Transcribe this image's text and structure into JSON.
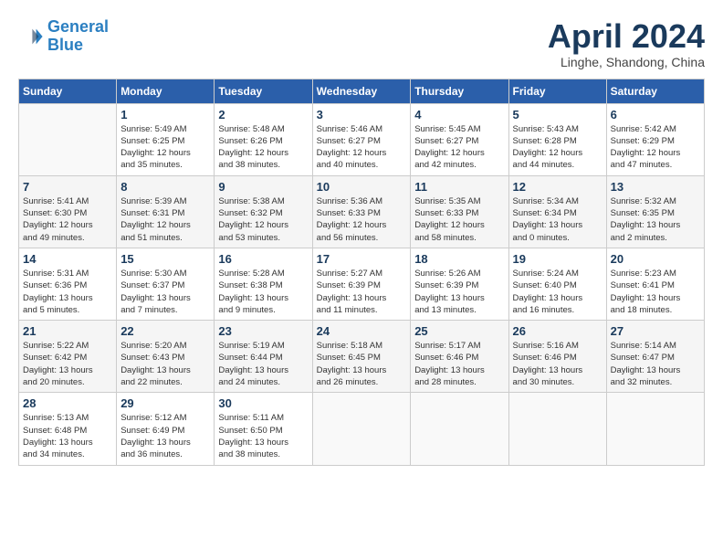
{
  "header": {
    "logo_line1": "General",
    "logo_line2": "Blue",
    "month": "April 2024",
    "location": "Linghe, Shandong, China"
  },
  "days_of_week": [
    "Sunday",
    "Monday",
    "Tuesday",
    "Wednesday",
    "Thursday",
    "Friday",
    "Saturday"
  ],
  "weeks": [
    [
      {
        "num": "",
        "info": ""
      },
      {
        "num": "1",
        "info": "Sunrise: 5:49 AM\nSunset: 6:25 PM\nDaylight: 12 hours\nand 35 minutes."
      },
      {
        "num": "2",
        "info": "Sunrise: 5:48 AM\nSunset: 6:26 PM\nDaylight: 12 hours\nand 38 minutes."
      },
      {
        "num": "3",
        "info": "Sunrise: 5:46 AM\nSunset: 6:27 PM\nDaylight: 12 hours\nand 40 minutes."
      },
      {
        "num": "4",
        "info": "Sunrise: 5:45 AM\nSunset: 6:27 PM\nDaylight: 12 hours\nand 42 minutes."
      },
      {
        "num": "5",
        "info": "Sunrise: 5:43 AM\nSunset: 6:28 PM\nDaylight: 12 hours\nand 44 minutes."
      },
      {
        "num": "6",
        "info": "Sunrise: 5:42 AM\nSunset: 6:29 PM\nDaylight: 12 hours\nand 47 minutes."
      }
    ],
    [
      {
        "num": "7",
        "info": "Sunrise: 5:41 AM\nSunset: 6:30 PM\nDaylight: 12 hours\nand 49 minutes."
      },
      {
        "num": "8",
        "info": "Sunrise: 5:39 AM\nSunset: 6:31 PM\nDaylight: 12 hours\nand 51 minutes."
      },
      {
        "num": "9",
        "info": "Sunrise: 5:38 AM\nSunset: 6:32 PM\nDaylight: 12 hours\nand 53 minutes."
      },
      {
        "num": "10",
        "info": "Sunrise: 5:36 AM\nSunset: 6:33 PM\nDaylight: 12 hours\nand 56 minutes."
      },
      {
        "num": "11",
        "info": "Sunrise: 5:35 AM\nSunset: 6:33 PM\nDaylight: 12 hours\nand 58 minutes."
      },
      {
        "num": "12",
        "info": "Sunrise: 5:34 AM\nSunset: 6:34 PM\nDaylight: 13 hours\nand 0 minutes."
      },
      {
        "num": "13",
        "info": "Sunrise: 5:32 AM\nSunset: 6:35 PM\nDaylight: 13 hours\nand 2 minutes."
      }
    ],
    [
      {
        "num": "14",
        "info": "Sunrise: 5:31 AM\nSunset: 6:36 PM\nDaylight: 13 hours\nand 5 minutes."
      },
      {
        "num": "15",
        "info": "Sunrise: 5:30 AM\nSunset: 6:37 PM\nDaylight: 13 hours\nand 7 minutes."
      },
      {
        "num": "16",
        "info": "Sunrise: 5:28 AM\nSunset: 6:38 PM\nDaylight: 13 hours\nand 9 minutes."
      },
      {
        "num": "17",
        "info": "Sunrise: 5:27 AM\nSunset: 6:39 PM\nDaylight: 13 hours\nand 11 minutes."
      },
      {
        "num": "18",
        "info": "Sunrise: 5:26 AM\nSunset: 6:39 PM\nDaylight: 13 hours\nand 13 minutes."
      },
      {
        "num": "19",
        "info": "Sunrise: 5:24 AM\nSunset: 6:40 PM\nDaylight: 13 hours\nand 16 minutes."
      },
      {
        "num": "20",
        "info": "Sunrise: 5:23 AM\nSunset: 6:41 PM\nDaylight: 13 hours\nand 18 minutes."
      }
    ],
    [
      {
        "num": "21",
        "info": "Sunrise: 5:22 AM\nSunset: 6:42 PM\nDaylight: 13 hours\nand 20 minutes."
      },
      {
        "num": "22",
        "info": "Sunrise: 5:20 AM\nSunset: 6:43 PM\nDaylight: 13 hours\nand 22 minutes."
      },
      {
        "num": "23",
        "info": "Sunrise: 5:19 AM\nSunset: 6:44 PM\nDaylight: 13 hours\nand 24 minutes."
      },
      {
        "num": "24",
        "info": "Sunrise: 5:18 AM\nSunset: 6:45 PM\nDaylight: 13 hours\nand 26 minutes."
      },
      {
        "num": "25",
        "info": "Sunrise: 5:17 AM\nSunset: 6:46 PM\nDaylight: 13 hours\nand 28 minutes."
      },
      {
        "num": "26",
        "info": "Sunrise: 5:16 AM\nSunset: 6:46 PM\nDaylight: 13 hours\nand 30 minutes."
      },
      {
        "num": "27",
        "info": "Sunrise: 5:14 AM\nSunset: 6:47 PM\nDaylight: 13 hours\nand 32 minutes."
      }
    ],
    [
      {
        "num": "28",
        "info": "Sunrise: 5:13 AM\nSunset: 6:48 PM\nDaylight: 13 hours\nand 34 minutes."
      },
      {
        "num": "29",
        "info": "Sunrise: 5:12 AM\nSunset: 6:49 PM\nDaylight: 13 hours\nand 36 minutes."
      },
      {
        "num": "30",
        "info": "Sunrise: 5:11 AM\nSunset: 6:50 PM\nDaylight: 13 hours\nand 38 minutes."
      },
      {
        "num": "",
        "info": ""
      },
      {
        "num": "",
        "info": ""
      },
      {
        "num": "",
        "info": ""
      },
      {
        "num": "",
        "info": ""
      }
    ]
  ]
}
